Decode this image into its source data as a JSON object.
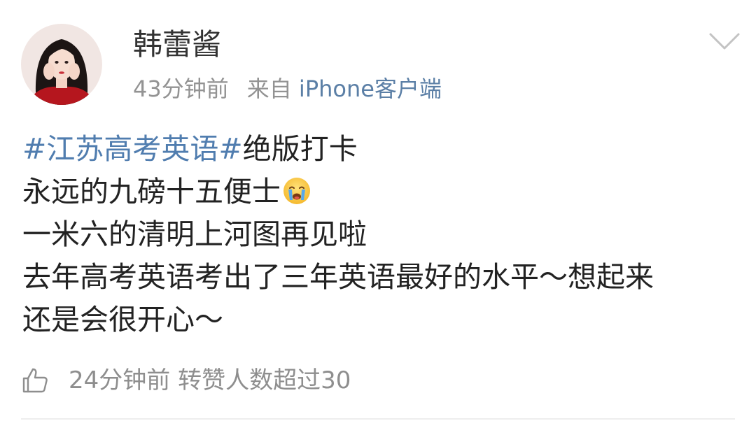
{
  "post": {
    "username": "韩蕾酱",
    "time": "43分钟前",
    "source_prefix": "来自",
    "source_device": "iPhone客户端",
    "content": {
      "hashtag": "#江苏高考英语#",
      "line1_rest": "绝版打卡",
      "line2": "永远的九磅十五便士",
      "line3": "一米六的清明上河图再见啦",
      "line4": "去年高考英语考出了三年英语最好的水平～想起来",
      "line5": "还是会很开心～"
    },
    "footer": {
      "text": "24分钟前 转赞人数超过30"
    }
  },
  "icons": {
    "avatar": "avatar",
    "menu": "chevron-down-icon",
    "emoji": "crying-face-emoji-icon",
    "like": "thumbs-up-icon"
  },
  "colors": {
    "hashtag": "#507daf",
    "device_link": "#5b7fa6",
    "meta_text": "#939393",
    "body_text": "#222222"
  }
}
